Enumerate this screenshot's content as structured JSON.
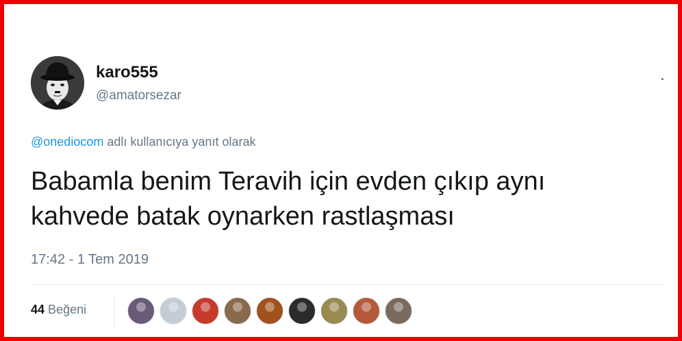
{
  "user": {
    "display_name": "karo555",
    "handle": "@amatorsezar",
    "avatar_icon": "profile-photo-bowler-hat"
  },
  "reply_context": {
    "mention": "@onediocom",
    "suffix": "adlı kullanıcıya yanıt olarak"
  },
  "tweet": {
    "text_lines": [
      "Babamla benim Teravih için evden çıkıp aynı",
      "kahvede batak oynarken rastlaşması"
    ],
    "timestamp": "17:42 - 1 Tem 2019"
  },
  "stats": {
    "like_count": "44",
    "like_label": "Beğeni"
  },
  "likers": [
    {
      "name": "liker-1",
      "color": "#6a5a7a"
    },
    {
      "name": "liker-2",
      "color": "#c4cdd5"
    },
    {
      "name": "liker-3",
      "color": "#c63b2c"
    },
    {
      "name": "liker-4",
      "color": "#8a6a4d"
    },
    {
      "name": "liker-5",
      "color": "#a0521d"
    },
    {
      "name": "liker-6",
      "color": "#2b2b2b"
    },
    {
      "name": "liker-7",
      "color": "#9a8a52"
    },
    {
      "name": "liker-8",
      "color": "#b45a3a"
    },
    {
      "name": "liker-9",
      "color": "#7a6a5e"
    }
  ],
  "colors": {
    "frame": "#ee0000",
    "text": "#14171a",
    "muted": "#657786",
    "link": "#1b95e0",
    "divider": "#e6ecf0"
  }
}
